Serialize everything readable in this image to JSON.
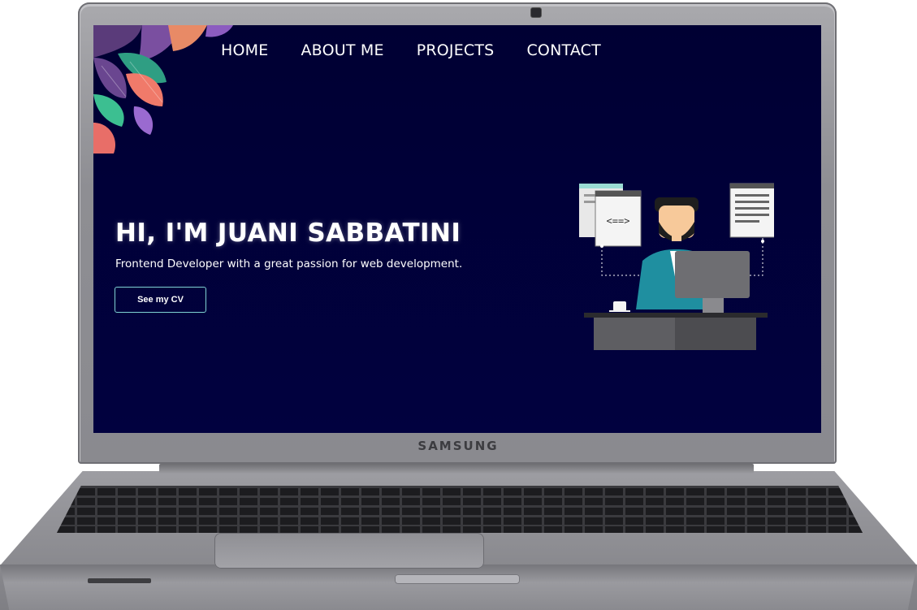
{
  "device": {
    "brand": "SAMSUNG"
  },
  "website": {
    "nav": {
      "items": [
        "HOME",
        "ABOUT ME",
        "PROJECTS",
        "CONTACT"
      ]
    },
    "hero": {
      "title": "HI, I'M JUANI SABBATINI",
      "subtitle": "Frontend Developer with a great passion for web development.",
      "cta_label": "See my CV"
    },
    "illustration": {
      "code_glyph": "<==>"
    },
    "colors": {
      "background": "#000033",
      "accent_border": "#7fd3d3",
      "text": "#ffffff"
    },
    "icons": [
      "tropical-leaves-decoration",
      "developer-at-desk-illustration"
    ]
  }
}
